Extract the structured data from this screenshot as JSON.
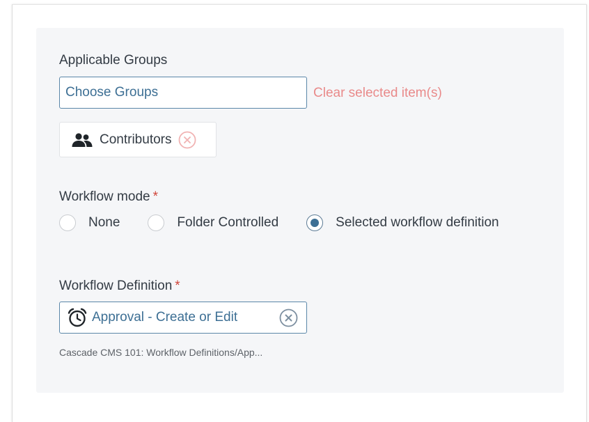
{
  "groups": {
    "label": "Applicable Groups",
    "placeholder": "Choose Groups",
    "clear_label": "Clear selected item(s)",
    "chips": [
      {
        "label": "Contributors",
        "icon": "people-icon"
      }
    ]
  },
  "workflow_mode": {
    "label": "Workflow mode",
    "required_mark": "*",
    "options": [
      {
        "label": "None",
        "selected": false
      },
      {
        "label": "Folder Controlled",
        "selected": false
      },
      {
        "label": "Selected workflow definition",
        "selected": true
      }
    ]
  },
  "workflow_definition": {
    "label": "Workflow Definition",
    "required_mark": "*",
    "value": "Approval - Create or Edit",
    "icon": "alarm-clock-icon",
    "path": "Cascade CMS 101: Workflow Definitions/App..."
  },
  "colors": {
    "accent": "#3d6f94",
    "required": "#d0453a",
    "clear_link": "#e98a8a",
    "panel_bg": "#f5f6f8"
  }
}
